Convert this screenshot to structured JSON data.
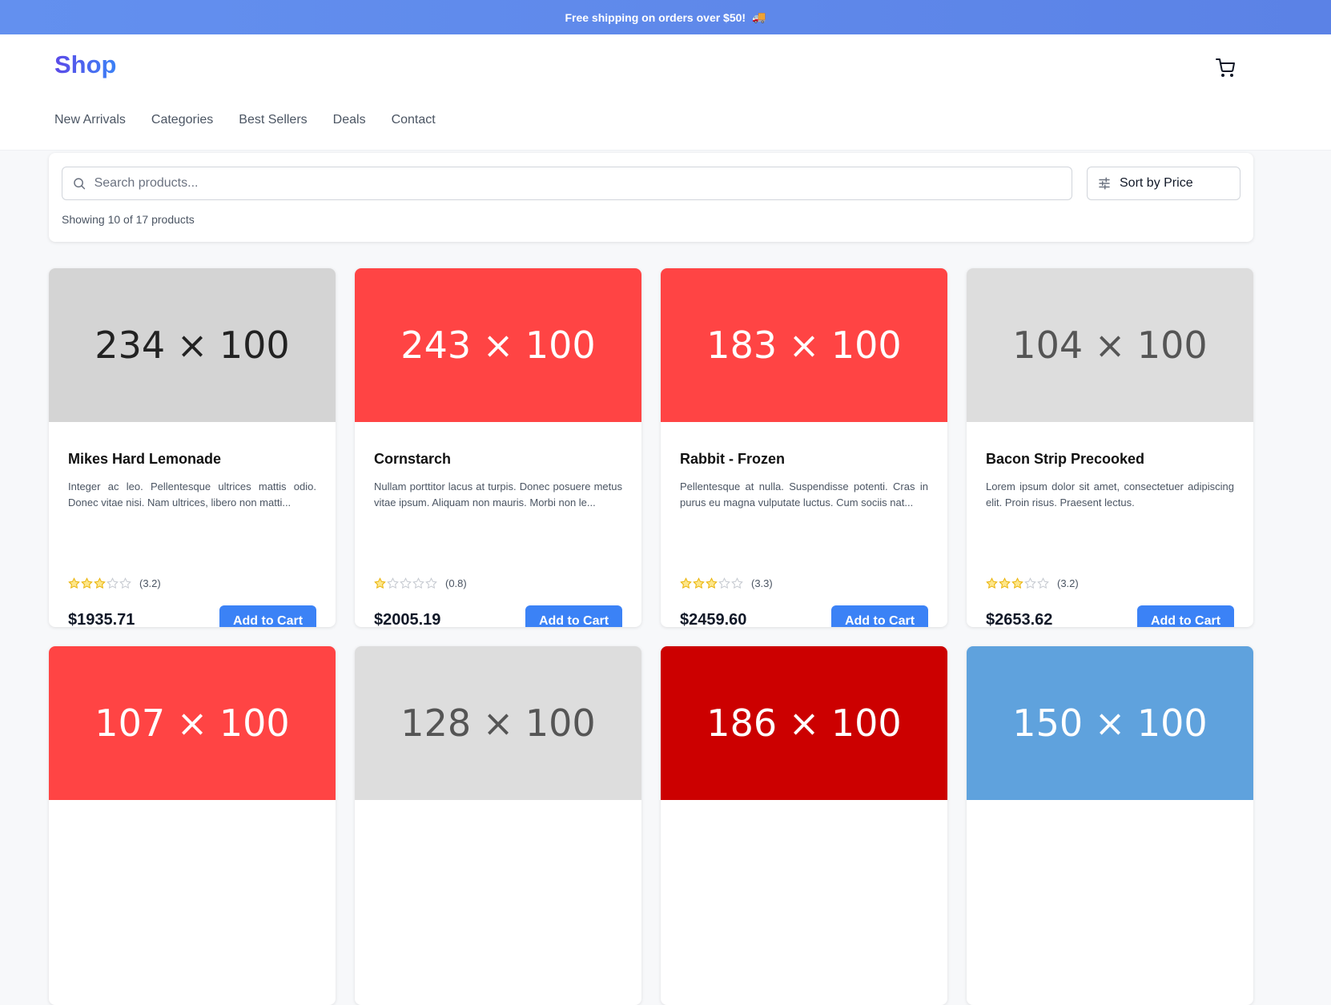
{
  "promo": {
    "text": "Free shipping on orders over $50!",
    "icon": "truck-icon"
  },
  "header": {
    "logo": "Shop",
    "cart_icon": "cart-icon"
  },
  "nav": [
    "New Arrivals",
    "Categories",
    "Best Sellers",
    "Deals",
    "Contact"
  ],
  "toolbar": {
    "search_placeholder": "Search products...",
    "sort_label": "Sort by Price",
    "count_text": "Showing 10 of 17 products"
  },
  "accent_color": "#3b82f6",
  "products": [
    {
      "image_label": "234 × 100",
      "image_bg": "#d4d4d4",
      "image_fg": "#222222",
      "name": "Mikes Hard Lemonade",
      "description": "Integer ac leo. Pellentesque ultrices mattis odio. Donec vitae nisi. Nam ultrices, libero non matti...",
      "rating": 3.2,
      "rating_text": "(3.2)",
      "price": "$1935.71",
      "button": "Add to Cart"
    },
    {
      "image_label": "243 × 100",
      "image_bg": "#ff4444",
      "image_fg": "#ffffff",
      "name": "Cornstarch",
      "description": "Nullam porttitor lacus at turpis. Donec posuere metus vitae ipsum. Aliquam non mauris. Morbi non le...",
      "rating": 0.8,
      "rating_text": "(0.8)",
      "price": "$2005.19",
      "button": "Add to Cart"
    },
    {
      "image_label": "183 × 100",
      "image_bg": "#ff4444",
      "image_fg": "#ffffff",
      "name": "Rabbit - Frozen",
      "description": "Pellentesque at nulla. Suspendisse potenti. Cras in purus eu magna vulputate luctus. Cum sociis nat...",
      "rating": 3.3,
      "rating_text": "(3.3)",
      "price": "$2459.60",
      "button": "Add to Cart"
    },
    {
      "image_label": "104 × 100",
      "image_bg": "#dddddd",
      "image_fg": "#555555",
      "name": "Bacon Strip Precooked",
      "description": "Lorem ipsum dolor sit amet, consectetuer adipiscing elit. Proin risus. Praesent lectus.",
      "rating": 3.2,
      "rating_text": "(3.2)",
      "price": "$2653.62",
      "button": "Add to Cart"
    },
    {
      "image_label": "107 × 100",
      "image_bg": "#ff4444",
      "image_fg": "#ffffff",
      "name": "",
      "description": "",
      "rating": null,
      "rating_text": "",
      "price": "",
      "button": ""
    },
    {
      "image_label": "128 × 100",
      "image_bg": "#dddddd",
      "image_fg": "#555555",
      "name": "",
      "description": "",
      "rating": null,
      "rating_text": "",
      "price": "",
      "button": ""
    },
    {
      "image_label": "186 × 100",
      "image_bg": "#cc0000",
      "image_fg": "#ffffff",
      "name": "",
      "description": "",
      "rating": null,
      "rating_text": "",
      "price": "",
      "button": ""
    },
    {
      "image_label": "150 × 100",
      "image_bg": "#5fa2dd",
      "image_fg": "#ffffff",
      "name": "",
      "description": "",
      "rating": null,
      "rating_text": "",
      "price": "",
      "button": ""
    }
  ]
}
